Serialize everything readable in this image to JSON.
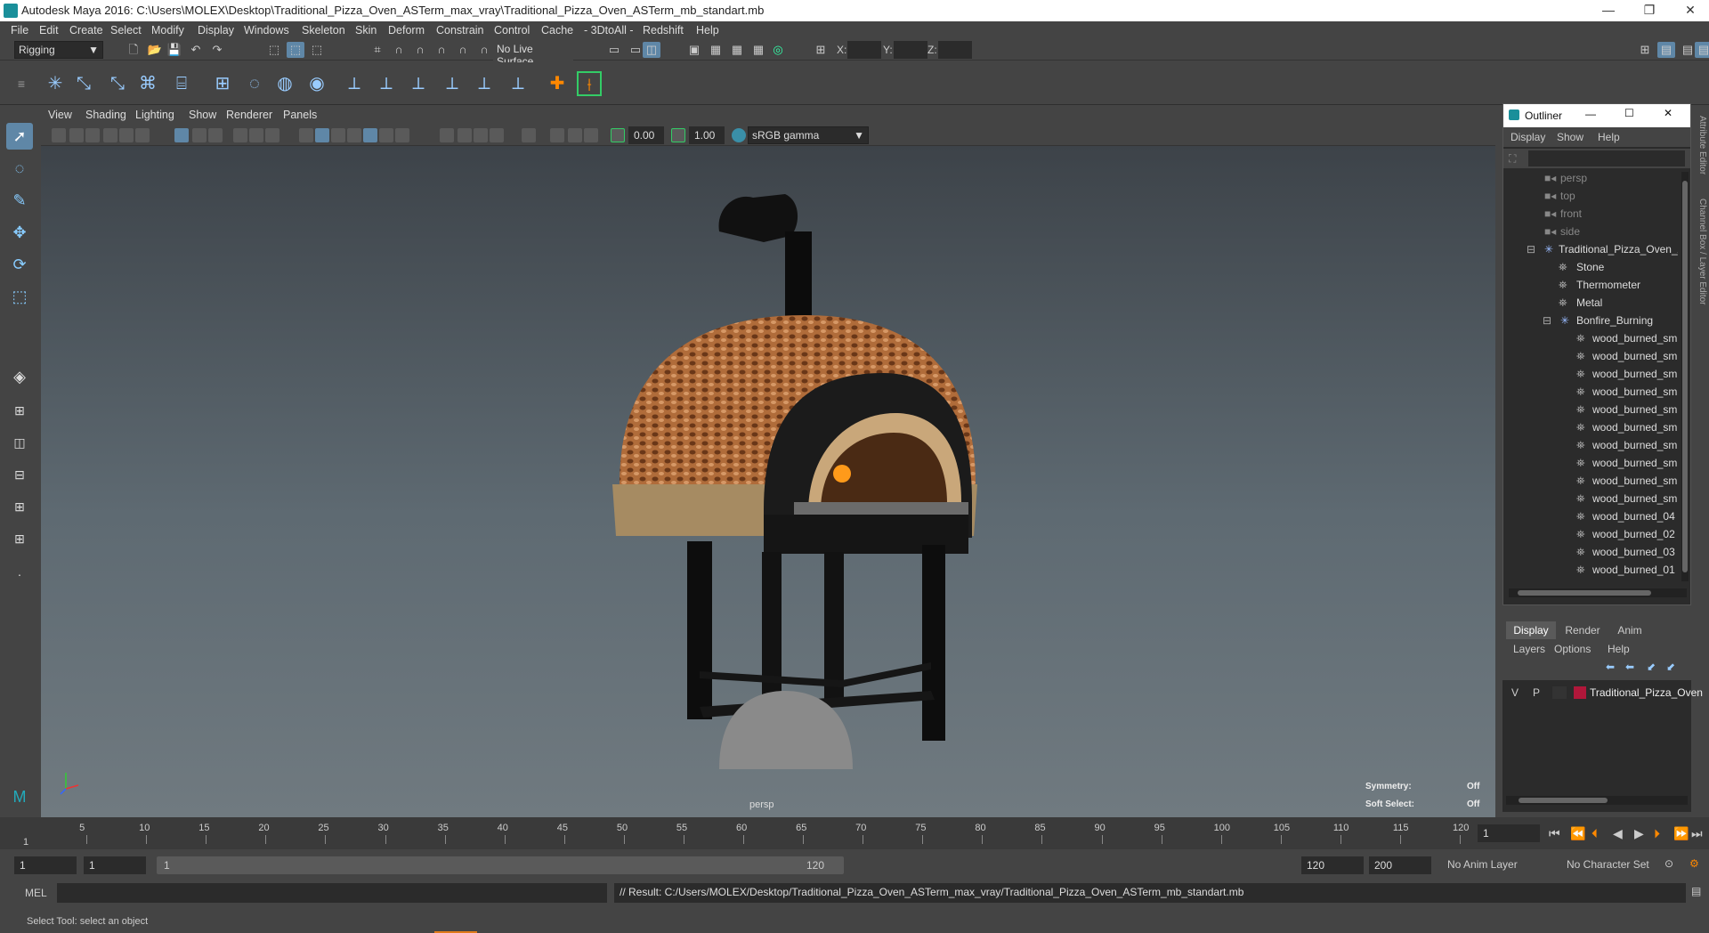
{
  "window": {
    "title": "Autodesk Maya 2016: C:\\Users\\MOLEX\\Desktop\\Traditional_Pizza_Oven_ASTerm_max_vray\\Traditional_Pizza_Oven_ASTerm_mb_standart.mb"
  },
  "menu": [
    "File",
    "Edit",
    "Create",
    "Select",
    "Modify",
    "Display",
    "Windows",
    "Skeleton",
    "Skin",
    "Deform",
    "Constrain",
    "Control",
    "Cache",
    "- 3DtoAll -",
    "Redshift",
    "Help"
  ],
  "status": {
    "mode": "Rigging",
    "live_surface": "No Live Surface",
    "x_label": "X:",
    "y_label": "Y:",
    "z_label": "Z:"
  },
  "viewport": {
    "menu": [
      "View",
      "Shading",
      "Lighting",
      "Show",
      "Renderer",
      "Panels"
    ],
    "exposure": "0.00",
    "gamma": "1.00",
    "color_space": "sRGB gamma",
    "camera": "persp",
    "symmetry_label": "Symmetry:",
    "symmetry_value": "Off",
    "soft_select_label": "Soft Select:",
    "soft_select_value": "Off"
  },
  "outliner": {
    "title": "Outliner",
    "menu": [
      "Display",
      "Show",
      "Help"
    ],
    "items": [
      {
        "label": "persp",
        "depth": 0,
        "type": "camera"
      },
      {
        "label": "top",
        "depth": 0,
        "type": "camera"
      },
      {
        "label": "front",
        "depth": 0,
        "type": "camera"
      },
      {
        "label": "side",
        "depth": 0,
        "type": "camera"
      },
      {
        "label": "Traditional_Pizza_Oven_AS",
        "depth": 0,
        "type": "group"
      },
      {
        "label": "Stone",
        "depth": 1,
        "type": "mesh"
      },
      {
        "label": "Thermometer",
        "depth": 1,
        "type": "mesh"
      },
      {
        "label": "Metal",
        "depth": 1,
        "type": "mesh"
      },
      {
        "label": "Bonfire_Burning",
        "depth": 1,
        "type": "group"
      },
      {
        "label": "wood_burned_sm",
        "depth": 2,
        "type": "mesh"
      },
      {
        "label": "wood_burned_sm",
        "depth": 2,
        "type": "mesh"
      },
      {
        "label": "wood_burned_sm",
        "depth": 2,
        "type": "mesh"
      },
      {
        "label": "wood_burned_sm",
        "depth": 2,
        "type": "mesh"
      },
      {
        "label": "wood_burned_sm",
        "depth": 2,
        "type": "mesh"
      },
      {
        "label": "wood_burned_sm",
        "depth": 2,
        "type": "mesh"
      },
      {
        "label": "wood_burned_sm",
        "depth": 2,
        "type": "mesh"
      },
      {
        "label": "wood_burned_sm",
        "depth": 2,
        "type": "mesh"
      },
      {
        "label": "wood_burned_sm",
        "depth": 2,
        "type": "mesh"
      },
      {
        "label": "wood_burned_sm",
        "depth": 2,
        "type": "mesh"
      },
      {
        "label": "wood_burned_04",
        "depth": 2,
        "type": "mesh"
      },
      {
        "label": "wood_burned_02",
        "depth": 2,
        "type": "mesh"
      },
      {
        "label": "wood_burned_03",
        "depth": 2,
        "type": "mesh"
      },
      {
        "label": "wood_burned_01",
        "depth": 2,
        "type": "mesh"
      }
    ]
  },
  "channel": {
    "tabs": [
      "Display",
      "Render",
      "Anim"
    ],
    "menu": [
      "Layers",
      "Options",
      "Help"
    ],
    "layer": {
      "v": "V",
      "p": "P",
      "name": "Traditional_Pizza_Oven",
      "color": "#b0173a"
    }
  },
  "side_tabs": {
    "attribute": "Attribute Editor",
    "channel": "Channel Box / Layer Editor"
  },
  "timeline": {
    "ticks": [
      5,
      10,
      15,
      20,
      25,
      30,
      35,
      40,
      45,
      50,
      55,
      60,
      65,
      70,
      75,
      80,
      85,
      90,
      95,
      100,
      105,
      110,
      115,
      120
    ],
    "start_label": "1",
    "current_frame": "1"
  },
  "range": {
    "start": "1",
    "playback_start": "1",
    "slider_start": "1",
    "slider_end": "120",
    "playback_end": "120",
    "end": "200",
    "anim_layer": "No Anim Layer",
    "character_set": "No Character Set"
  },
  "cmd": {
    "label": "MEL",
    "result": "// Result: C:/Users/MOLEX/Desktop/Traditional_Pizza_Oven_ASTerm_max_vray/Traditional_Pizza_Oven_ASTerm_mb_standart.mb"
  },
  "help": {
    "text": "Select Tool: select an object"
  }
}
